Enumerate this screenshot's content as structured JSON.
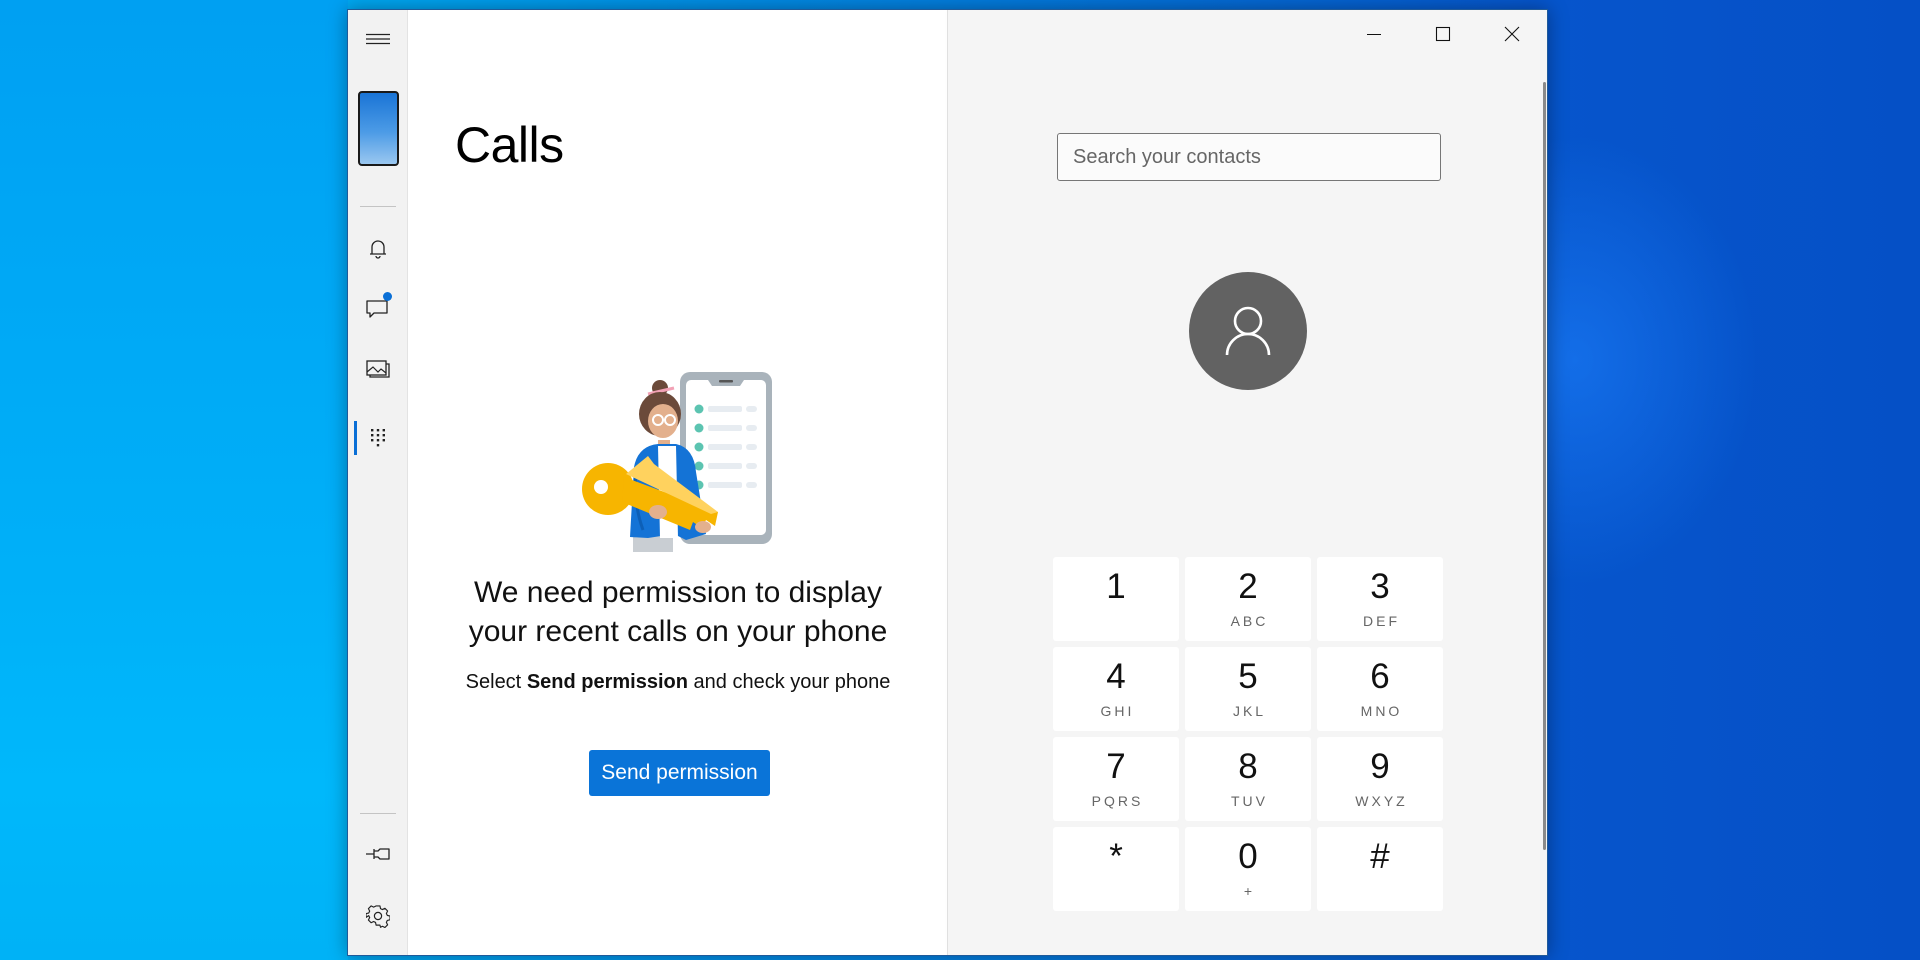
{
  "desktop": {
    "colors": {
      "left": "#00a8f2",
      "right": "#0550c6"
    }
  },
  "window": {
    "caption_buttons": {
      "minimize": "minimize-icon",
      "maximize": "maximize-icon",
      "close": "close-icon"
    }
  },
  "sidebar": {
    "menu_icon": "hamburger-menu-icon",
    "phone_icon": "phone-thumbnail",
    "items": [
      {
        "id": "notifications",
        "icon": "bell-icon",
        "active": false,
        "badge": false
      },
      {
        "id": "messages",
        "icon": "chat-icon",
        "active": false,
        "badge": true
      },
      {
        "id": "photos",
        "icon": "photos-icon",
        "active": false,
        "badge": false
      },
      {
        "id": "calls",
        "icon": "dialpad-icon",
        "active": true,
        "badge": false
      }
    ],
    "bottom_items": [
      {
        "id": "pin",
        "icon": "pin-icon"
      },
      {
        "id": "settings",
        "icon": "gear-icon"
      }
    ],
    "accent_color": "#0a6fd6"
  },
  "calls": {
    "title": "Calls",
    "permission_heading_line1": "We need permission to display",
    "permission_heading_line2": "your recent calls on your phone",
    "permission_sub_prefix": "Select ",
    "permission_sub_bold": "Send permission",
    "permission_sub_suffix": " and check your phone",
    "send_button_label": "Send permission",
    "button_color": "#0a74d8"
  },
  "dialer": {
    "search_placeholder": "Search your contacts",
    "search_value": "",
    "avatar_icon": "person-icon",
    "keys": [
      {
        "digit": "1",
        "letters": ""
      },
      {
        "digit": "2",
        "letters": "ABC"
      },
      {
        "digit": "3",
        "letters": "DEF"
      },
      {
        "digit": "4",
        "letters": "GHI"
      },
      {
        "digit": "5",
        "letters": "JKL"
      },
      {
        "digit": "6",
        "letters": "MNO"
      },
      {
        "digit": "7",
        "letters": "PQRS"
      },
      {
        "digit": "8",
        "letters": "TUV"
      },
      {
        "digit": "9",
        "letters": "WXYZ"
      },
      {
        "digit": "*",
        "letters": ""
      },
      {
        "digit": "0",
        "letters": "+"
      },
      {
        "digit": "#",
        "letters": ""
      }
    ]
  }
}
